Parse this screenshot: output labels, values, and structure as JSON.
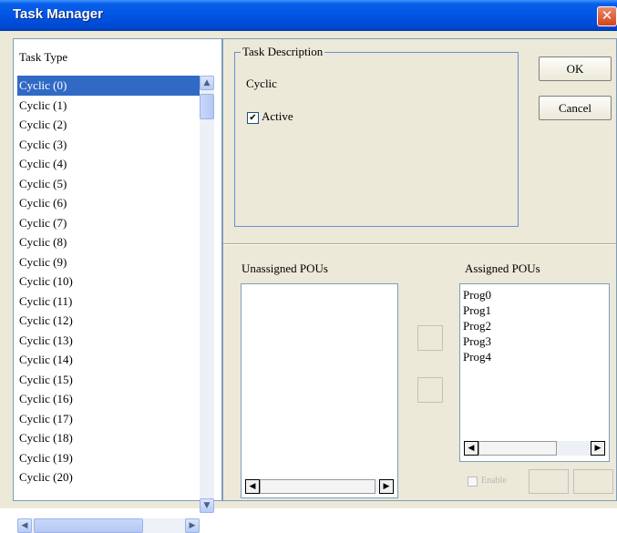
{
  "window": {
    "title": "Task Manager",
    "close_glyph": "✕"
  },
  "task_type": {
    "label": "Task Type",
    "items": [
      "Cyclic (0)",
      "Cyclic (1)",
      "Cyclic (2)",
      "Cyclic (3)",
      "Cyclic (4)",
      "Cyclic (5)",
      "Cyclic (6)",
      "Cyclic (7)",
      "Cyclic (8)",
      "Cyclic (9)",
      "Cyclic (10)",
      "Cyclic (11)",
      "Cyclic (12)",
      "Cyclic (13)",
      "Cyclic (14)",
      "Cyclic (15)",
      "Cyclic (16)",
      "Cyclic (17)",
      "Cyclic (18)",
      "Cyclic (19)",
      "Cyclic (20)"
    ],
    "selected_index": 0
  },
  "task_description": {
    "legend": "Task Description",
    "type_text": "Cyclic",
    "active_label": "Active",
    "active_checked": true
  },
  "buttons": {
    "ok": "OK",
    "cancel": "Cancel"
  },
  "pous": {
    "unassigned_label": "Unassigned POUs",
    "assigned_label": "Assigned POUs",
    "unassigned": [],
    "assigned": [
      "Prog0",
      "Prog1",
      "Prog2",
      "Prog3",
      "Prog4"
    ],
    "option_label": "Enable"
  },
  "icons": {
    "scroll_up": "▲",
    "scroll_down": "▼",
    "scroll_left": "◀",
    "scroll_right": "▶",
    "check": "✔"
  }
}
